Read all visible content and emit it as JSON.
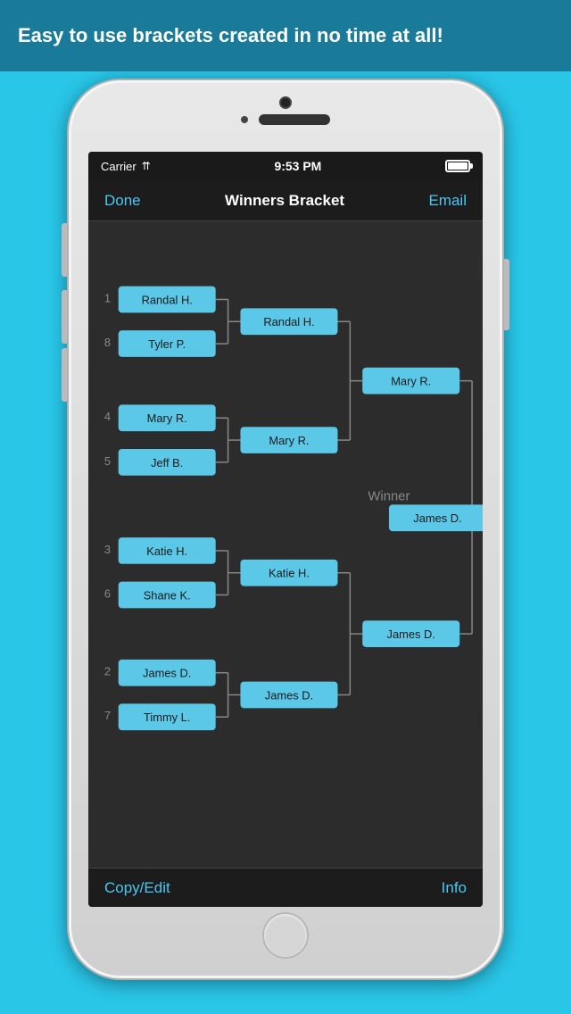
{
  "banner": {
    "text": "Easy to use brackets created in no time at all!"
  },
  "status_bar": {
    "carrier": "Carrier",
    "time": "9:53 PM"
  },
  "nav": {
    "done": "Done",
    "title": "Winners Bracket",
    "email": "Email"
  },
  "bracket": {
    "round1": [
      {
        "seed": "1",
        "name": "Randal H."
      },
      {
        "seed": "8",
        "name": "Tyler P."
      },
      {
        "seed": "4",
        "name": "Mary R."
      },
      {
        "seed": "5",
        "name": "Jeff B."
      },
      {
        "seed": "3",
        "name": "Katie H."
      },
      {
        "seed": "6",
        "name": "Shane K."
      },
      {
        "seed": "2",
        "name": "James D."
      },
      {
        "seed": "7",
        "name": "Timmy L."
      }
    ],
    "round2": [
      {
        "name": "Randal H."
      },
      {
        "name": "Mary R."
      },
      {
        "name": "Katie H."
      },
      {
        "name": "James D."
      }
    ],
    "round3": [
      {
        "name": "Mary R."
      },
      {
        "name": "James D."
      }
    ],
    "winner": {
      "label": "Winner",
      "name": "James D."
    }
  },
  "toolbar": {
    "copy_edit": "Copy/Edit",
    "info": "Info"
  },
  "colors": {
    "box_bg": "#5bc8e8",
    "box_text": "#1a1a1a",
    "line": "#888",
    "seed": "#888"
  }
}
